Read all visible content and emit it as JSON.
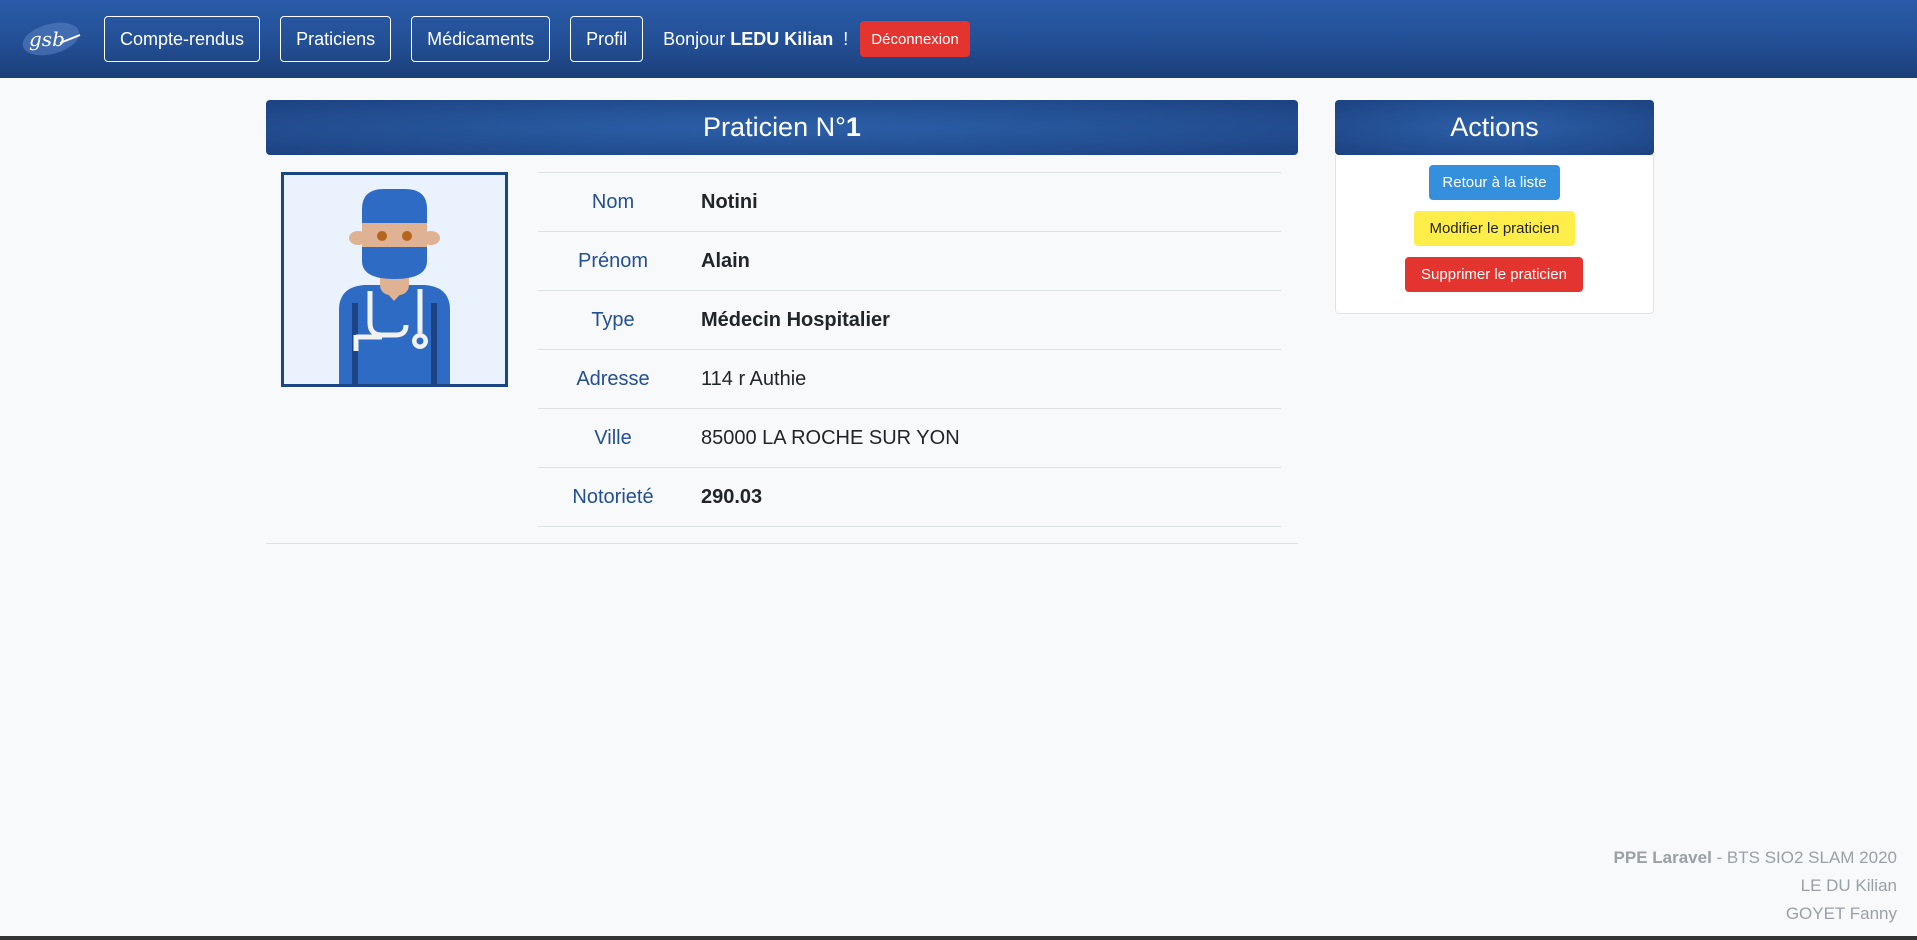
{
  "navbar": {
    "logo_text": "gsb",
    "links": [
      {
        "label": "Compte-rendus"
      },
      {
        "label": "Praticiens"
      },
      {
        "label": "Médicaments"
      },
      {
        "label": "Profil"
      }
    ],
    "greeting_prefix": "Bonjour",
    "user_name": "LEDU Kilian",
    "greeting_suffix": "!",
    "logout_label": "Déconnexion"
  },
  "practitioner": {
    "title_prefix": "Praticien N°",
    "number": "1",
    "fields": [
      {
        "label": "Nom",
        "value": "Notini"
      },
      {
        "label": "Prénom",
        "value": "Alain"
      },
      {
        "label": "Type",
        "value": "Médecin Hospitalier"
      },
      {
        "label": "Adresse",
        "value": "114 r Authie"
      },
      {
        "label": "Ville",
        "value": "85000 LA ROCHE SUR YON"
      },
      {
        "label": "Notorieté",
        "value": "290.03"
      }
    ],
    "avatar_icon": "doctor-avatar"
  },
  "actions": {
    "title": "Actions",
    "back_label": "Retour à la liste",
    "edit_label": "Modifier le praticien",
    "delete_label": "Supprimer le praticien"
  },
  "footer": {
    "project": "PPE Laravel",
    "subtitle": " - BTS SIO2 SLAM 2020",
    "author1": "LE DU Kilian",
    "author2": "GOYET Fanny"
  },
  "colors": {
    "primary": "#234f95",
    "danger": "#e3342f",
    "info": "#3490dc",
    "warning": "#ffed4a"
  }
}
